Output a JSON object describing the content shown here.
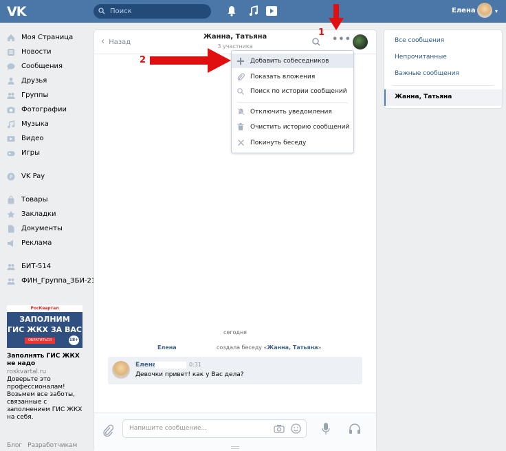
{
  "header": {
    "search_placeholder": "Поиск",
    "user_name": "Елена"
  },
  "sidebar": {
    "items": [
      {
        "label": "Моя Страница",
        "icon": "home-icon"
      },
      {
        "label": "Новости",
        "icon": "news-icon"
      },
      {
        "label": "Сообщения",
        "icon": "messages-icon"
      },
      {
        "label": "Друзья",
        "icon": "friends-icon"
      },
      {
        "label": "Группы",
        "icon": "groups-icon"
      },
      {
        "label": "Фотографии",
        "icon": "photos-icon"
      },
      {
        "label": "Музыка",
        "icon": "music-icon"
      },
      {
        "label": "Видео",
        "icon": "video-icon"
      },
      {
        "label": "Игры",
        "icon": "games-icon"
      }
    ],
    "pay_label": "VK Pay",
    "items2": [
      {
        "label": "Товары",
        "icon": "goods-icon"
      },
      {
        "label": "Закладки",
        "icon": "bookmarks-icon"
      },
      {
        "label": "Документы",
        "icon": "documents-icon"
      },
      {
        "label": "Реклама",
        "icon": "ads-icon"
      }
    ],
    "groups": [
      {
        "label": "БИТ-514",
        "icon": "group-icon"
      },
      {
        "label": "ФИН_Группа_ЗБИ-21",
        "icon": "group-icon"
      }
    ]
  },
  "ad": {
    "brand": "РосКвартал",
    "line1": "ЗАПОЛНИМ",
    "line2": "ГИС ЖКХ ЗА ВАС",
    "button": "ОБРАТИТЬСЯ",
    "age": "18+",
    "title": "Заполнять ГИС ЖКХ не надо",
    "site": "roskvartal.ru",
    "text": "Доверьте это профессионалам! Возьмем все заботы, связанные с заполнением ГИС ЖКХ на себя."
  },
  "footer": {
    "blog": "Блог",
    "dev": "Разработчикам"
  },
  "chat": {
    "back_label": "Назад",
    "title": "Жанна, Татьяна",
    "subtitle": "3 участника",
    "date_label": "сегодня",
    "system_author": "Елена",
    "system_text_prefix": "создала беседу «",
    "system_text_name": "Жанна, Татьяна",
    "system_text_suffix": "»",
    "message": {
      "author": "Елена",
      "time": "0:31",
      "text": "Девочки привет! как у Вас дела?"
    },
    "input_placeholder": "Напишите сообщение..."
  },
  "menu": {
    "items": [
      {
        "label": "Добавить собеседников",
        "icon": "plus-icon",
        "highlighted": true
      },
      {
        "label": "Показать вложения",
        "icon": "attachment-icon"
      },
      {
        "label": "Поиск по истории сообщений",
        "icon": "search-icon"
      },
      {
        "label": "Отключить уведомления",
        "icon": "mute-icon"
      },
      {
        "label": "Очистить историю сообщений",
        "icon": "trash-icon"
      },
      {
        "label": "Покинуть беседу",
        "icon": "close-icon"
      }
    ]
  },
  "right_panel": {
    "items": [
      "Все сообщения",
      "Непрочитанные",
      "Важные сообщения"
    ],
    "active_chat": "Жанна, Татьяна"
  },
  "annotations": {
    "step1": "1",
    "step2": "2"
  },
  "colors": {
    "header": "#4a76a8",
    "link": "#2a5885",
    "annotation": "#e01010",
    "menu_highlight": "#e5ebf1"
  }
}
